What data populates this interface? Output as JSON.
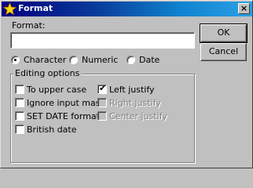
{
  "window": {
    "title": "Format",
    "close_glyph": "×",
    "icon": "star-icon"
  },
  "format_field": {
    "label": "Format:",
    "value": ""
  },
  "buttons": {
    "ok": "OK",
    "cancel": "Cancel"
  },
  "type_options": [
    {
      "label": "Character",
      "selected": true
    },
    {
      "label": "Numeric",
      "selected": false
    },
    {
      "label": "Date",
      "selected": false
    }
  ],
  "editing_options": {
    "legend": "Editing options",
    "left_column": [
      {
        "label": "To upper case",
        "checked": false,
        "enabled": true
      },
      {
        "label": "Ignore input mask",
        "checked": false,
        "enabled": true
      },
      {
        "label": "SET DATE format",
        "checked": false,
        "enabled": true
      },
      {
        "label": "British date",
        "checked": false,
        "enabled": true
      }
    ],
    "right_column": [
      {
        "label": "Left justify",
        "checked": true,
        "enabled": true
      },
      {
        "label": "Right justify",
        "checked": false,
        "enabled": false
      },
      {
        "label": "Center justify",
        "checked": false,
        "enabled": false
      }
    ]
  },
  "colors": {
    "title_gradient_start": "#000080",
    "title_gradient_end": "#2aa0e6",
    "dialog_face": "#c0c0c0"
  }
}
